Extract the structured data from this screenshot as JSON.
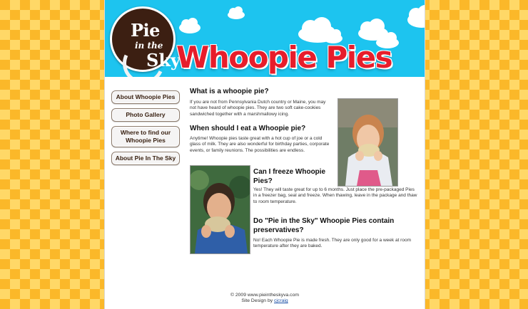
{
  "logo": {
    "line1": "Pie",
    "line2": "in the",
    "line3": "Sky"
  },
  "banner": {
    "title": "Whoopie Pies"
  },
  "nav": [
    {
      "label": "About Whoopie Pies"
    },
    {
      "label": "Photo Gallery"
    },
    {
      "label": "Where to find our Whoopie Pies"
    },
    {
      "label": "About Pie In The Sky"
    }
  ],
  "faq": [
    {
      "q": "What is a whoopie pie?",
      "a": "If you are not from Pennsylvania Dutch country or Maine, you may not have heard of whoopie pies. They are two soft cake-cookies sandwiched together with a marshmallowy icing."
    },
    {
      "q": "When should I eat a Whoopie pie?",
      "a": "Anytime! Whoopie pies taste great with a hot cup of joe or a cold glass of milk. They are also wonderful for birthday parties, corporate events, or family reunions. The possibilities are endless."
    },
    {
      "q": "Can I freeze Whoopie Pies?",
      "a": "Yes! They will taste great for up to 6 months. Just place the pre-packaged Pies in a freezer bag, seal and freeze. When thawing, leave in the package and thaw to room temperature."
    },
    {
      "q": "Do \"Pie in the Sky\" Whoopie Pies contain preservatives?",
      "a": "No! Each Whoopie Pie is made fresh. They are only good for a week at room temperature after they are baked."
    }
  ],
  "footer": {
    "copyright": "© 2009 www.pieintheskyva.com",
    "design_prefix": "Site Design by",
    "designer": "cjcraig"
  },
  "colors": {
    "sky": "#1dc4ef",
    "title_red": "#e71d2b",
    "brown": "#3c1f12",
    "background": "#fbb829"
  }
}
